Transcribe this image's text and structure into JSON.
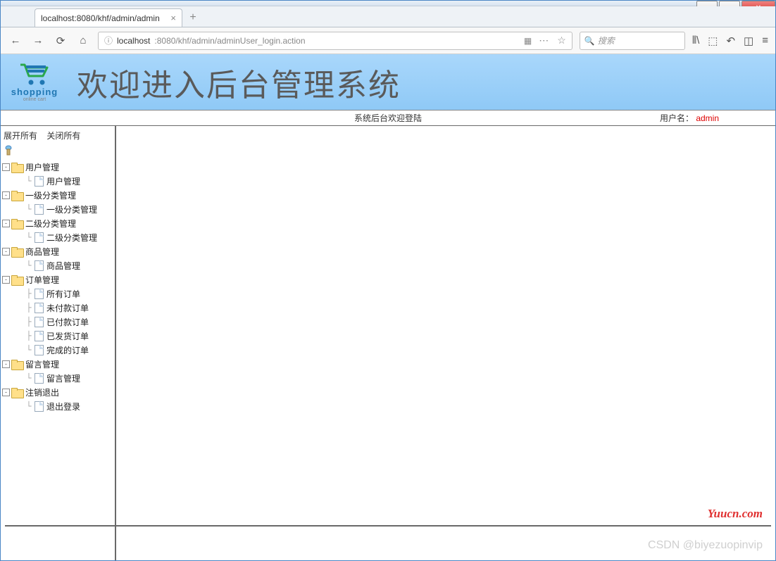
{
  "browser": {
    "tab_title": "localhost:8080/khf/admin/admin",
    "url_prefix": "localhost",
    "url_rest": ":8080/khf/admin/adminUser_login.action",
    "search_placeholder": "搜索"
  },
  "banner": {
    "logo_text1": "shopping",
    "logo_text2": "online cart",
    "title": "欢迎进入后台管理系统"
  },
  "sysbar": {
    "center": "系统后台欢迎登陆",
    "user_label": "用户名：",
    "user_name": "admin"
  },
  "sidebar": {
    "expand_all": "展开所有",
    "collapse_all": "关闭所有",
    "nodes": [
      {
        "label": "用户管理",
        "children": [
          {
            "label": "用户管理"
          }
        ]
      },
      {
        "label": "一级分类管理",
        "children": [
          {
            "label": "一级分类管理"
          }
        ]
      },
      {
        "label": "二级分类管理",
        "children": [
          {
            "label": "二级分类管理"
          }
        ]
      },
      {
        "label": "商品管理",
        "children": [
          {
            "label": "商品管理"
          }
        ]
      },
      {
        "label": "订单管理",
        "children": [
          {
            "label": "所有订单"
          },
          {
            "label": "未付款订单"
          },
          {
            "label": "已付款订单"
          },
          {
            "label": "已发货订单"
          },
          {
            "label": "完成的订单"
          }
        ]
      },
      {
        "label": "留言管理",
        "children": [
          {
            "label": "留言管理"
          }
        ]
      },
      {
        "label": "注销退出",
        "children": [
          {
            "label": "退出登录"
          }
        ]
      }
    ]
  },
  "watermarks": {
    "w1": "Yuucn.com",
    "w2": "CSDN @biyezuopinvip"
  }
}
